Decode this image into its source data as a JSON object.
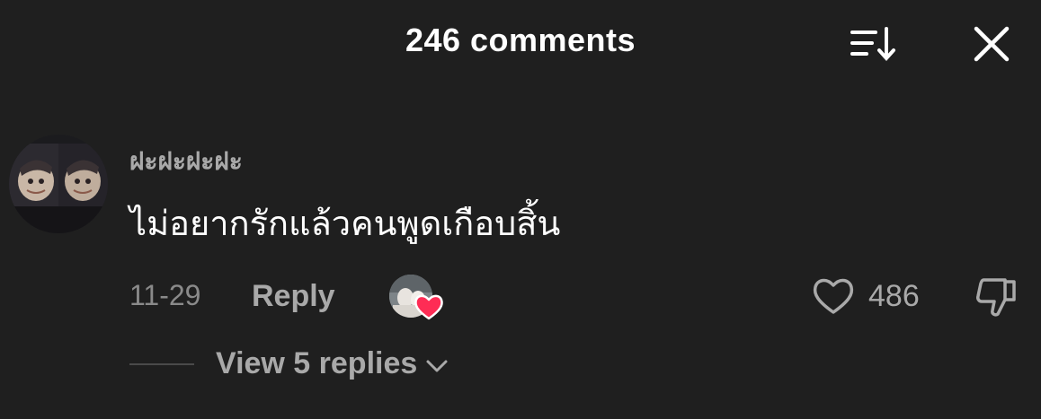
{
  "header": {
    "title": "246 comments",
    "sort_icon": "sort-descending-icon",
    "close_icon": "close-icon"
  },
  "comment": {
    "username": "ฝะฝะฝะฝะ",
    "text": "ไม่อยากรักแล้วคนพูดเกือบสิ้น",
    "timestamp": "11-29",
    "reply_label": "Reply",
    "like_count": "486",
    "creator_liked_icon": "heart-icon",
    "like_icon": "heart-outline-icon",
    "dislike_icon": "thumbs-down-icon",
    "view_replies_label": "View 5 replies",
    "view_replies_icon": "chevron-down-icon"
  },
  "colors": {
    "background": "#1f1f1f",
    "primary_text": "#ffffff",
    "secondary_text": "#a9a9a9",
    "muted_text": "#8a8a8a",
    "heart_red": "#fe2c55"
  }
}
